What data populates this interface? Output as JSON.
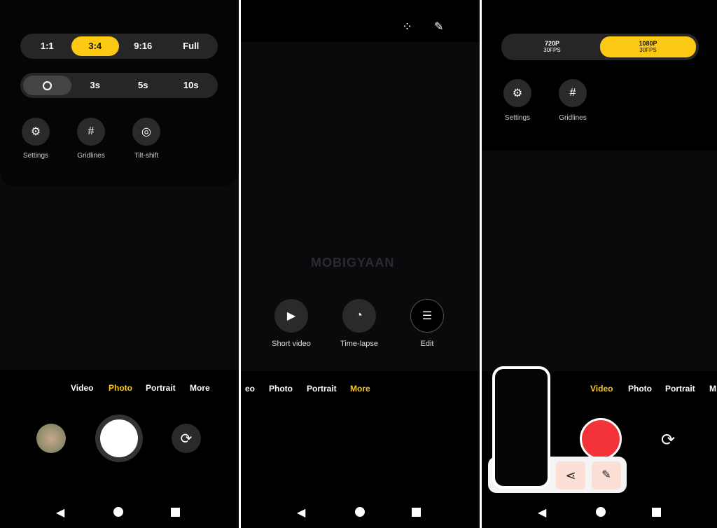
{
  "panel1": {
    "aspect_ratios": [
      {
        "label": "1:1"
      },
      {
        "label": "3:4",
        "selected": true
      },
      {
        "label": "9:16"
      },
      {
        "label": "Full"
      }
    ],
    "timer": {
      "icon": "clock-icon",
      "options": [
        "3s",
        "5s",
        "10s"
      ]
    },
    "tools": [
      {
        "label": "Settings",
        "icon": "gear-icon"
      },
      {
        "label": "Gridlines",
        "icon": "grid-icon"
      },
      {
        "label": "Tilt-shift",
        "icon": "tilt-shift-icon"
      }
    ],
    "modes": [
      "Video",
      "Photo",
      "Portrait",
      "More"
    ],
    "active_mode": "Photo"
  },
  "panel2": {
    "top_icons": [
      "apps-grid-icon",
      "edit-square-icon"
    ],
    "watermark": "MOBIGYAAN",
    "more_options": [
      {
        "label": "Short video",
        "icon": "play-circle-icon"
      },
      {
        "label": "Time-lapse",
        "icon": "timelapse-icon"
      },
      {
        "label": "Edit",
        "icon": "sliders-icon"
      }
    ],
    "modes": [
      "eo",
      "Photo",
      "Portrait",
      "More"
    ],
    "active_mode": "More"
  },
  "panel3": {
    "resolutions": [
      {
        "res": "720P",
        "fps": "30FPS"
      },
      {
        "res": "1080P",
        "fps": "30FPS",
        "selected": true
      }
    ],
    "tools": [
      {
        "label": "Settings",
        "icon": "gear-icon"
      },
      {
        "label": "Gridlines",
        "icon": "grid-icon"
      }
    ],
    "modes": [
      "Video",
      "Photo",
      "Portrait",
      "M"
    ],
    "active_mode": "Video",
    "screenshot_actions": [
      "share-icon",
      "pencil-icon"
    ]
  },
  "colors": {
    "accent": "#fcc914",
    "record": "#f2343a",
    "screenshot_bg": "#fde0d5"
  }
}
